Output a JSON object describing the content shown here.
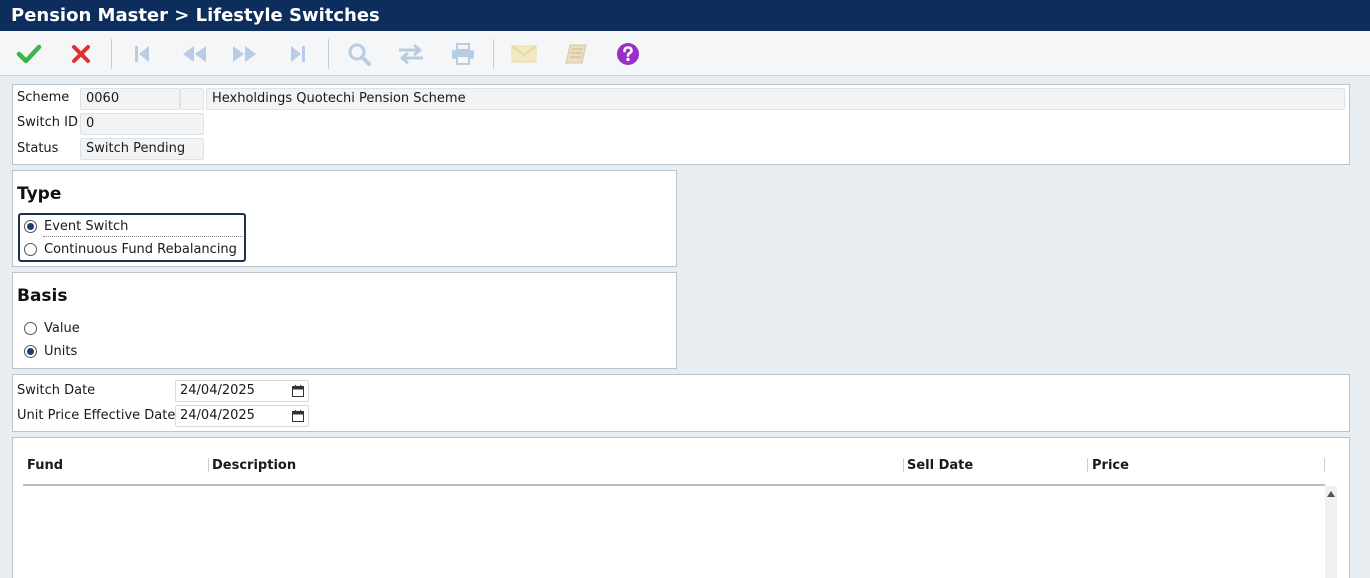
{
  "window": {
    "title": "Pension Master > Lifestyle Switches"
  },
  "toolbar": {
    "buttons": [
      {
        "name": "save-button",
        "icon": "check-icon",
        "enabled": true,
        "color": "#3ab54a"
      },
      {
        "name": "cancel-button",
        "icon": "close-icon",
        "enabled": true,
        "color": "#e03030"
      },
      {
        "name": "first-record-button",
        "icon": "skip-first-icon",
        "enabled": false
      },
      {
        "name": "previous-record-button",
        "icon": "rewind-icon",
        "enabled": false
      },
      {
        "name": "next-record-button",
        "icon": "fast-forward-icon",
        "enabled": false
      },
      {
        "name": "last-record-button",
        "icon": "skip-last-icon",
        "enabled": false
      },
      {
        "name": "search-button",
        "icon": "search-icon",
        "enabled": false
      },
      {
        "name": "switch-button",
        "icon": "swap-arrows-icon",
        "enabled": false
      },
      {
        "name": "print-button",
        "icon": "printer-icon",
        "enabled": false
      },
      {
        "name": "email-button",
        "icon": "envelope-icon",
        "enabled": false
      },
      {
        "name": "notes-button",
        "icon": "book-icon",
        "enabled": false
      },
      {
        "name": "help-button",
        "icon": "help-icon",
        "enabled": true,
        "color": "#9a2fc6"
      }
    ]
  },
  "header": {
    "scheme_label": "Scheme",
    "scheme_code": "0060",
    "scheme_name": "Hexholdings Quotechi Pension Scheme",
    "switch_id_label": "Switch ID",
    "switch_id": "0",
    "status_label": "Status",
    "status": "Switch Pending"
  },
  "type": {
    "title": "Type",
    "options": [
      {
        "label": "Event Switch",
        "selected": true
      },
      {
        "label": "Continuous Fund Rebalancing",
        "selected": false
      }
    ]
  },
  "basis": {
    "title": "Basis",
    "options": [
      {
        "label": "Value",
        "selected": false
      },
      {
        "label": "Units",
        "selected": true
      }
    ]
  },
  "dates": {
    "switch_date_label": "Switch Date",
    "switch_date": "24/04/2025",
    "unit_price_label": "Unit Price Effective Date",
    "unit_price_date": "24/04/2025"
  },
  "grid": {
    "columns": [
      "Fund",
      "Description",
      "Sell Date",
      "Price"
    ],
    "rows": []
  },
  "colors": {
    "title_bar": "#0d2d5c",
    "accent": "#1d3d6e",
    "disabled_icon": "#b8cde3"
  }
}
